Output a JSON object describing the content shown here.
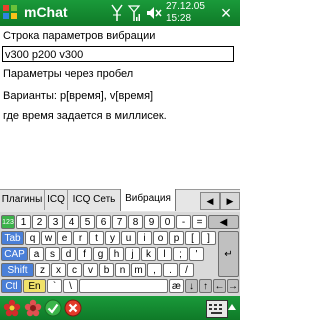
{
  "titlebar": {
    "title": "mChat",
    "time_line1": "27.12.05",
    "time_line2": "15:28",
    "close_label": "×"
  },
  "content": {
    "field_label": "Строка параметров вибрации",
    "field_value": "v300 p200 v300",
    "hint1": "Параметры через пробел",
    "hint2": "Варианты: p[время], v[время]",
    "hint3": "где время задается в миллисек."
  },
  "tabs": {
    "items": [
      "Плагины",
      "ICQ",
      "ICQ Сеть",
      "Вибрация"
    ],
    "active": "Вибрация",
    "left_arrow": "◀",
    "right_arrow": "▶"
  },
  "keyboard": {
    "row1": [
      "123",
      "1",
      "2",
      "3",
      "4",
      "5",
      "6",
      "7",
      "8",
      "9",
      "0",
      "-",
      "=",
      "◀"
    ],
    "row2": [
      "Tab",
      "q",
      "w",
      "e",
      "r",
      "t",
      "y",
      "u",
      "i",
      "o",
      "p",
      "[",
      "]"
    ],
    "row3": [
      "CAP",
      "a",
      "s",
      "d",
      "f",
      "g",
      "h",
      "j",
      "k",
      "l",
      ";",
      "'"
    ],
    "row4": [
      "Shift",
      "z",
      "x",
      "c",
      "v",
      "b",
      "n",
      "m",
      ",",
      ".",
      "/",
      "↵"
    ],
    "row5": [
      "Ctl",
      "En",
      "`",
      "\\",
      "æ",
      "↓",
      "↑",
      "←",
      "→"
    ]
  },
  "colors": {
    "bar_green": "#138a30",
    "key_blue": "#4a7fd8",
    "key_green": "#3cb34a",
    "key_yellow": "#f1e26a"
  }
}
